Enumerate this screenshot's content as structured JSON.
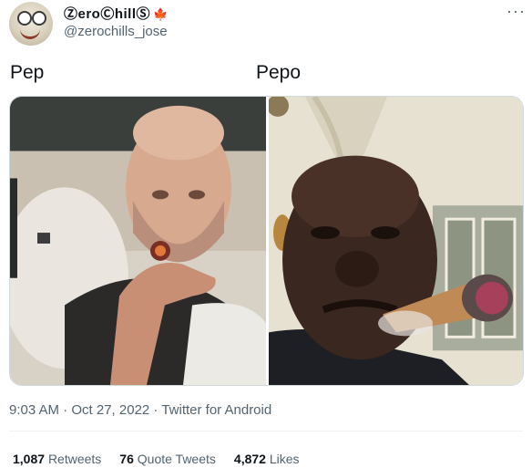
{
  "author": {
    "display_name": "ⓏeroⒸhillⓈ",
    "flag_icon": "canada-flag-icon",
    "handle": "@zerochills_jose"
  },
  "more_icon": "more-icon",
  "captions": {
    "left": "Pep",
    "right": "Pepo"
  },
  "media": {
    "left_photo": "man-smoking-cigar-photo",
    "right_photo": "man-smoking-cigar-selfie-photo"
  },
  "timestamp": "9:03 AM · Oct 27, 2022 · Twitter for Android",
  "stats": {
    "retweets_count": "1,087",
    "retweets_label": "Retweets",
    "quotes_count": "76",
    "quotes_label": "Quote Tweets",
    "likes_count": "4,872",
    "likes_label": "Likes"
  }
}
